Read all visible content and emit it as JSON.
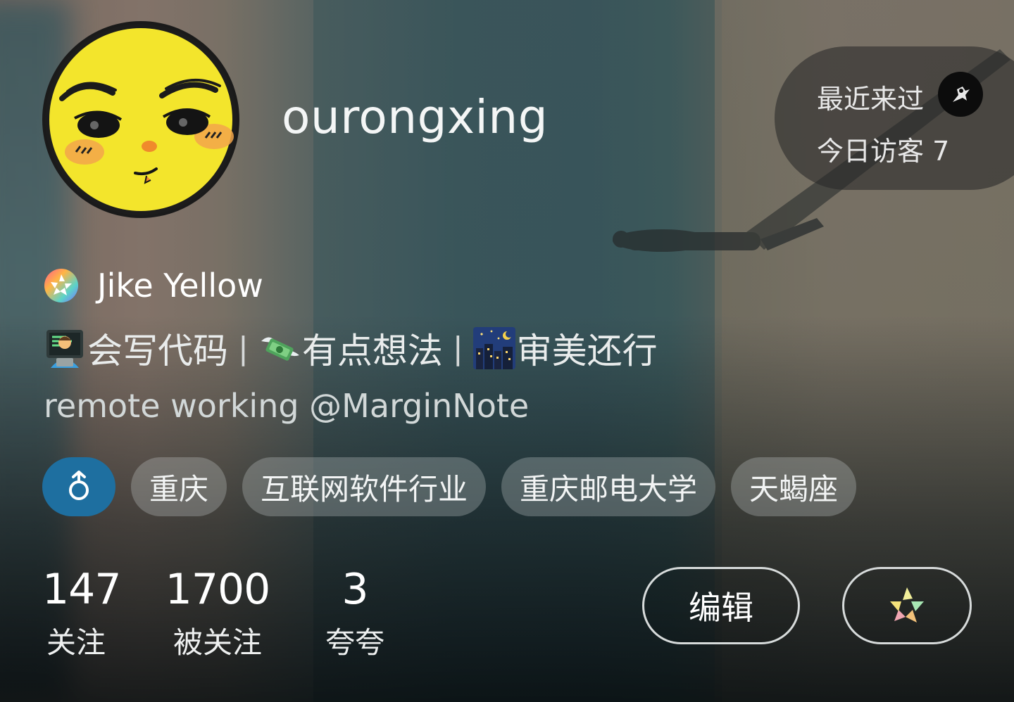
{
  "profile": {
    "username": "ourongxing",
    "badge": {
      "icon": "jike-colorful-badge-icon",
      "label": "Jike Yellow"
    },
    "bio": {
      "segments": [
        {
          "emoji": "technologist-emoji",
          "text": "会写代码"
        },
        {
          "emoji": "money-with-wings-emoji",
          "text": "有点想法"
        },
        {
          "emoji": "night-city-emoji",
          "text": "审美还行"
        }
      ],
      "separator": "|",
      "line2": "remote working @MarginNote"
    },
    "tags": [
      {
        "type": "gender",
        "icon": "male-gender-icon"
      },
      {
        "type": "text",
        "label": "重庆"
      },
      {
        "type": "text",
        "label": "互联网软件行业"
      },
      {
        "type": "text",
        "label": "重庆邮电大学"
      },
      {
        "type": "text",
        "label": "天蝎座"
      }
    ]
  },
  "visitors": {
    "recent_label": "最近来过",
    "today_label": "今日访客 7"
  },
  "stats": [
    {
      "value": "147",
      "label": "关注"
    },
    {
      "value": "1700",
      "label": "被关注"
    },
    {
      "value": "3",
      "label": "夸夸"
    }
  ],
  "actions": {
    "edit_label": "编辑",
    "jike_icon": "jike-logo-icon"
  },
  "colors": {
    "gender_tag": "#1e6fa0",
    "avatar_yellow": "#f3e52c"
  }
}
